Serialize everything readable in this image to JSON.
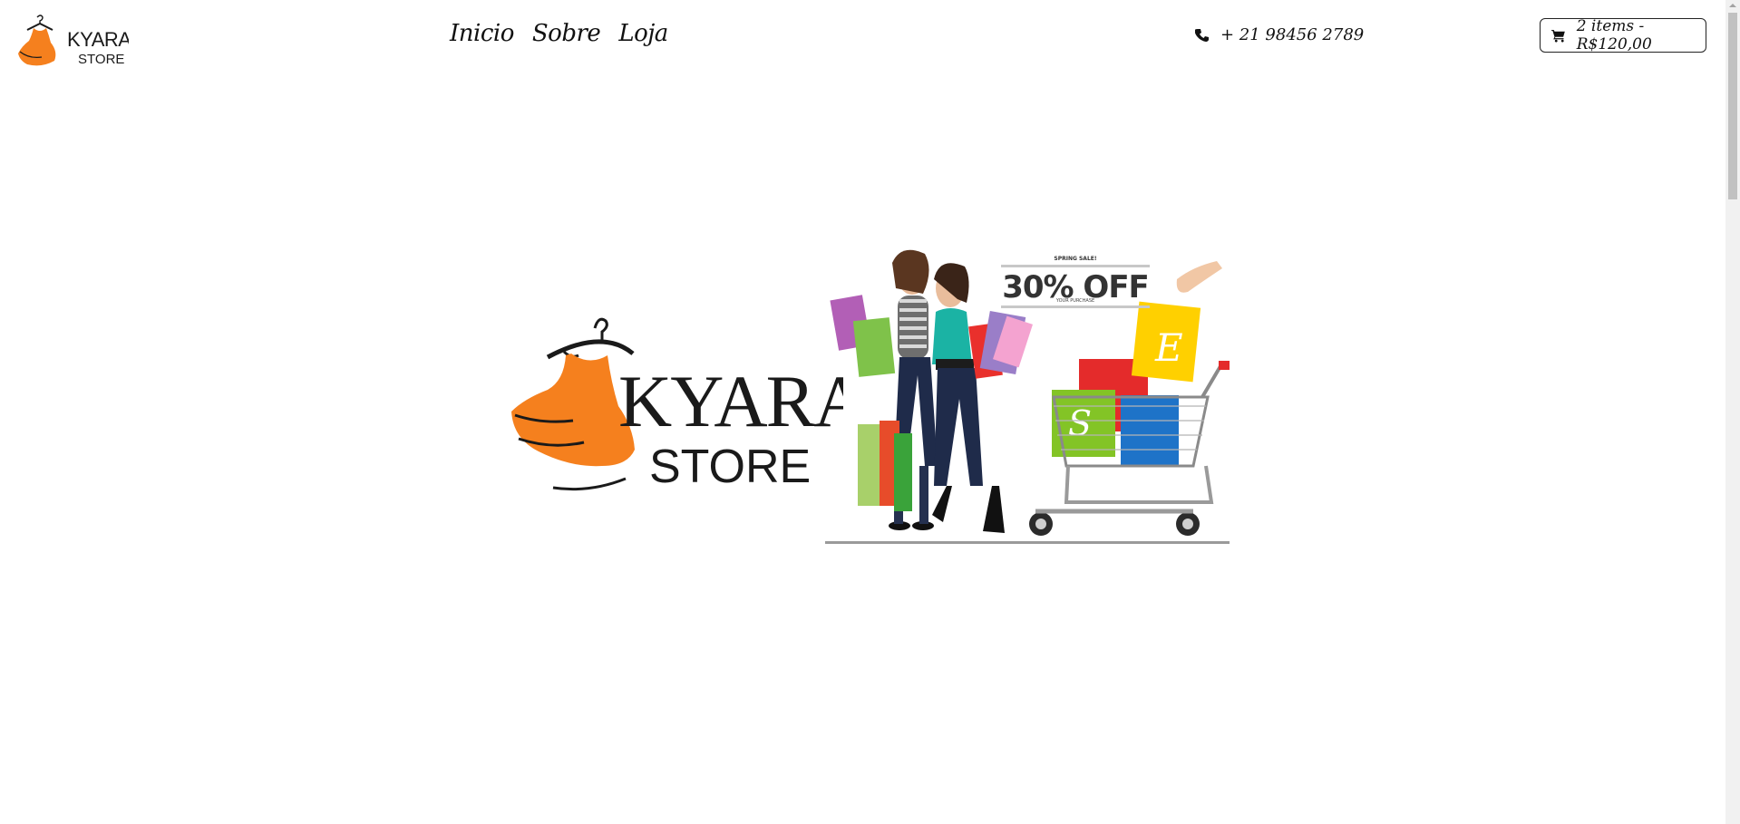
{
  "header": {
    "nav": [
      {
        "label": "Inicio"
      },
      {
        "label": "Sobre"
      },
      {
        "label": "Loja"
      }
    ],
    "phone": "+ 21 98456 2789",
    "cart": "2 items - R$120,00"
  },
  "hero": {
    "promo_kicker": "SPRING SALE!",
    "promo_headline": "30% OFF",
    "promo_sub": "YOUR PURCHASE"
  },
  "brand": {
    "name_line1": "KYARA",
    "name_line2": "STORE",
    "orange": "#f5801e",
    "dark": "#1a1a1a"
  },
  "icons": {
    "phone": "phone-icon",
    "cart": "shopping-cart-icon"
  }
}
